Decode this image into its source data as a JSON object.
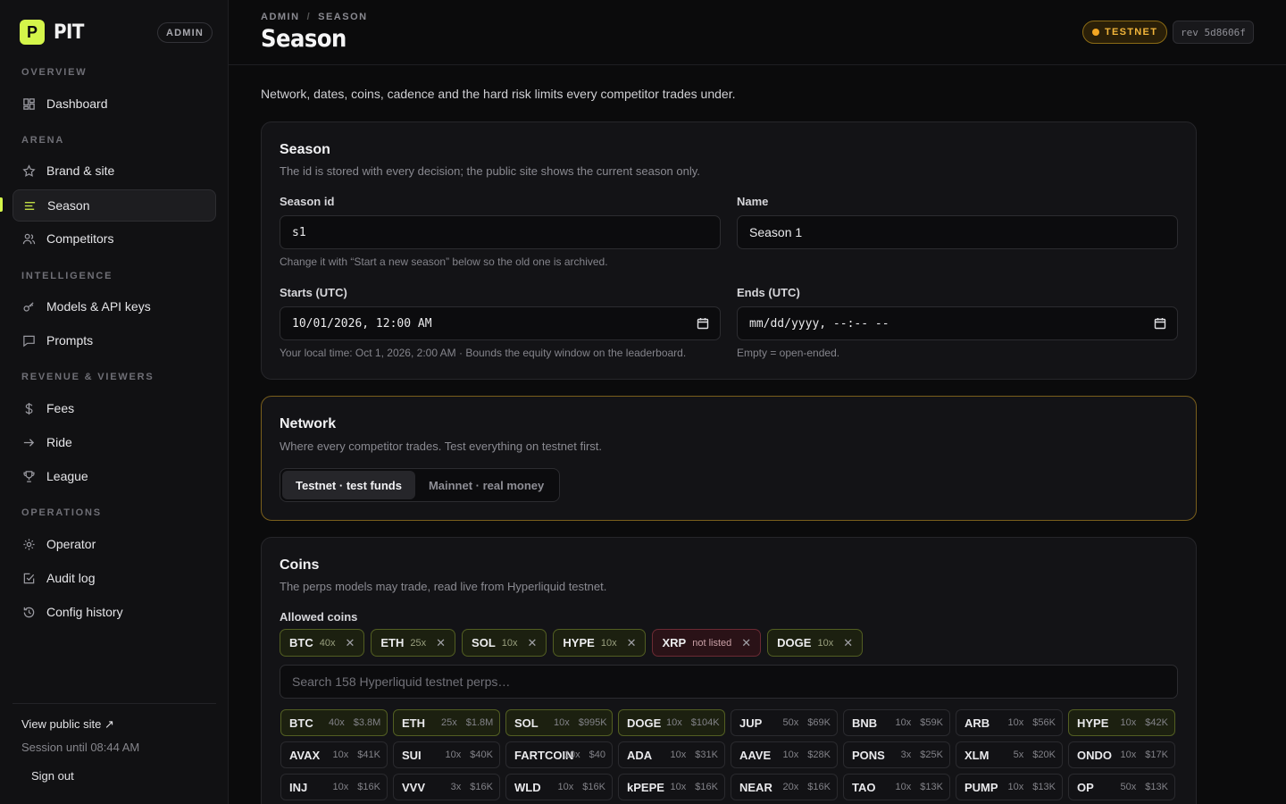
{
  "brand": {
    "logo_letter": "P",
    "name": "PIT",
    "role": "ADMIN"
  },
  "nav": {
    "sections": {
      "overview": "OVERVIEW",
      "arena": "ARENA",
      "intelligence": "INTELLIGENCE",
      "revenue": "REVENUE & VIEWERS",
      "operations": "OPERATIONS"
    },
    "items": {
      "dashboard": "Dashboard",
      "brand": "Brand & site",
      "season": "Season",
      "competitors": "Competitors",
      "models": "Models & API keys",
      "prompts": "Prompts",
      "fees": "Fees",
      "ride": "Ride",
      "league": "League",
      "operator": "Operator",
      "audit": "Audit log",
      "config": "Config history"
    },
    "footer": {
      "public_site": "View public site ↗",
      "session": "Session until 08:44 AM",
      "signout": "Sign out"
    }
  },
  "header": {
    "crumb_root": "ADMIN",
    "crumb_sep": "/",
    "crumb_current": "SEASON",
    "title": "Season",
    "network_badge": "TESTNET",
    "revision": "rev 5d8606f"
  },
  "intro": "Network, dates, coins, cadence and the hard risk limits every competitor trades under.",
  "season_card": {
    "title": "Season",
    "subtitle": "The id is stored with every decision; the public site shows the current season only.",
    "id_label": "Season id",
    "id_value": "s1",
    "id_hint": "Change it with “Start a new season” below so the old one is archived.",
    "name_label": "Name",
    "name_value": "Season 1",
    "starts_label": "Starts (UTC)",
    "starts_value": "10/01/2026, 12:00 AM",
    "starts_hint": "Your local time: Oct 1, 2026, 2:00 AM · Bounds the equity window on the leaderboard.",
    "ends_label": "Ends (UTC)",
    "ends_value": "mm/dd/yyyy, --:-- --",
    "ends_hint": "Empty = open-ended."
  },
  "network_card": {
    "title": "Network",
    "subtitle": "Where every competitor trades. Test everything on testnet first.",
    "testnet_option": "Testnet · test funds",
    "mainnet_option": "Mainnet · real money"
  },
  "coins_card": {
    "title": "Coins",
    "subtitle": "The perps models may trade, read live from Hyperliquid testnet.",
    "allowed_label": "Allowed coins",
    "allowed": [
      {
        "sym": "BTC",
        "note": "40x"
      },
      {
        "sym": "ETH",
        "note": "25x"
      },
      {
        "sym": "SOL",
        "note": "10x"
      },
      {
        "sym": "HYPE",
        "note": "10x"
      },
      {
        "sym": "XRP",
        "note": "not listed"
      },
      {
        "sym": "DOGE",
        "note": "10x"
      }
    ],
    "search_placeholder": "Search 158 Hyperliquid testnet perps…",
    "perps": [
      {
        "sym": "BTC",
        "lev": "40x",
        "vol": "$3.8M",
        "selected": true
      },
      {
        "sym": "ETH",
        "lev": "25x",
        "vol": "$1.8M",
        "selected": true
      },
      {
        "sym": "SOL",
        "lev": "10x",
        "vol": "$995K",
        "selected": true
      },
      {
        "sym": "DOGE",
        "lev": "10x",
        "vol": "$104K",
        "selected": true
      },
      {
        "sym": "JUP",
        "lev": "50x",
        "vol": "$69K",
        "selected": false
      },
      {
        "sym": "BNB",
        "lev": "10x",
        "vol": "$59K",
        "selected": false
      },
      {
        "sym": "ARB",
        "lev": "10x",
        "vol": "$56K",
        "selected": false
      },
      {
        "sym": "HYPE",
        "lev": "10x",
        "vol": "$42K",
        "selected": true
      },
      {
        "sym": "AVAX",
        "lev": "10x",
        "vol": "$41K",
        "selected": false
      },
      {
        "sym": "SUI",
        "lev": "10x",
        "vol": "$40K",
        "selected": false
      },
      {
        "sym": "FARTCOIN",
        "lev": "10x",
        "vol": "$40",
        "selected": false
      },
      {
        "sym": "ADA",
        "lev": "10x",
        "vol": "$31K",
        "selected": false
      },
      {
        "sym": "AAVE",
        "lev": "10x",
        "vol": "$28K",
        "selected": false
      },
      {
        "sym": "PONS",
        "lev": "3x",
        "vol": "$25K",
        "selected": false
      },
      {
        "sym": "XLM",
        "lev": "5x",
        "vol": "$20K",
        "selected": false
      },
      {
        "sym": "ONDO",
        "lev": "10x",
        "vol": "$17K",
        "selected": false
      },
      {
        "sym": "INJ",
        "lev": "10x",
        "vol": "$16K",
        "selected": false
      },
      {
        "sym": "VVV",
        "lev": "3x",
        "vol": "$16K",
        "selected": false
      },
      {
        "sym": "WLD",
        "lev": "10x",
        "vol": "$16K",
        "selected": false
      },
      {
        "sym": "kPEPE",
        "lev": "10x",
        "vol": "$16K",
        "selected": false
      },
      {
        "sym": "NEAR",
        "lev": "20x",
        "vol": "$16K",
        "selected": false
      },
      {
        "sym": "TAO",
        "lev": "10x",
        "vol": "$13K",
        "selected": false
      },
      {
        "sym": "PUMP",
        "lev": "10x",
        "vol": "$13K",
        "selected": false
      },
      {
        "sym": "OP",
        "lev": "50x",
        "vol": "$13K",
        "selected": false
      }
    ]
  },
  "colors": {
    "accent": "#d4f54a",
    "warning": "#f2a623",
    "danger": "#6b2a33"
  }
}
